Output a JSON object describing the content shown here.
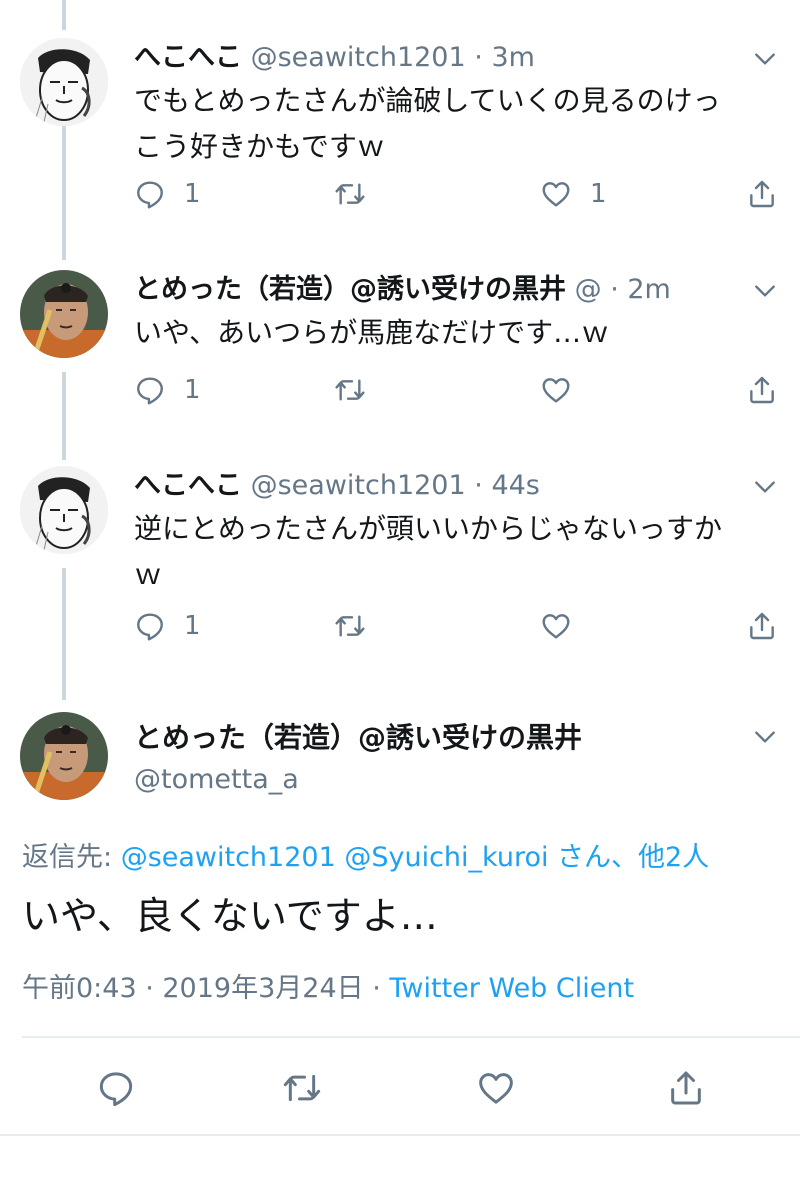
{
  "tweets": [
    {
      "name": "へこへこ",
      "handle": "@seawitch1201",
      "time": "3m",
      "text_lines": [
        "でもとめったさんが論破していくの見るのけっ",
        "こう好きかもですｗ"
      ],
      "reply_count": "1",
      "retweet_count": "",
      "like_count": "1"
    },
    {
      "name": "とめった（若造）@誘い受けの黒井",
      "handle": "@",
      "time": "2m",
      "text_lines": [
        "いや、あいつらが馬鹿なだけです…ｗ"
      ],
      "reply_count": "1",
      "retweet_count": "",
      "like_count": ""
    },
    {
      "name": "へこへこ",
      "handle": "@seawitch1201",
      "time": "44s",
      "text_lines": [
        "逆にとめったさんが頭いいからじゃないっすか",
        "ｗ"
      ],
      "reply_count": "1",
      "retweet_count": "",
      "like_count": ""
    }
  ],
  "main_tweet": {
    "name": "とめった（若造）@誘い受けの黒井",
    "handle": "@tometta_a",
    "reply_prefix": "返信先: ",
    "reply_users": "@seawitch1201 @Syuichi_kuroi さん、他2人",
    "text": "いや、良くないですよ…",
    "timestamp": "午前0:43 · 2019年3月24日 · ",
    "client": "Twitter Web Client"
  },
  "separator_dot": "·",
  "icons": {
    "reply": "reply-icon",
    "retweet": "retweet-icon",
    "like": "heart-icon",
    "share": "share-icon",
    "caret": "chevron-down-icon"
  },
  "colors": {
    "link": "#1da1f2",
    "secondary_text": "#657786",
    "thread_line": "#ccd6dd"
  }
}
